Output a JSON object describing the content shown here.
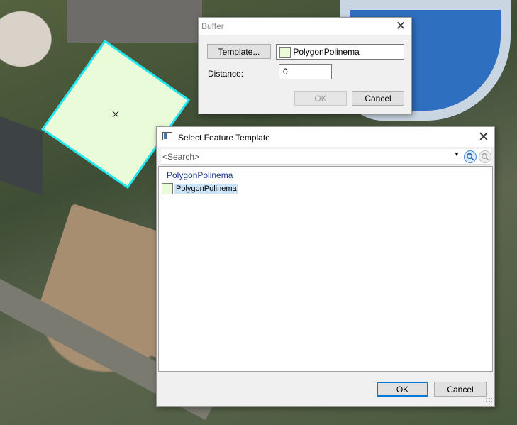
{
  "buffer_dialog": {
    "title": "Buffer",
    "template_button": "Template...",
    "template_value": "PolygonPolinema",
    "distance_label": "Distance:",
    "distance_value": "0",
    "ok": "OK",
    "cancel": "Cancel"
  },
  "select_template_dialog": {
    "title": "Select Feature Template",
    "search_placeholder": "<Search>",
    "group_header": "PolygonPolinema",
    "items": [
      {
        "label": "PolygonPolinema",
        "swatch_color": "#e9fbd9"
      }
    ],
    "ok": "OK",
    "cancel": "Cancel"
  },
  "colors": {
    "feature_fill": "#e9fbd9",
    "feature_outline": "#20e8f0",
    "accent": "#0078d7"
  }
}
